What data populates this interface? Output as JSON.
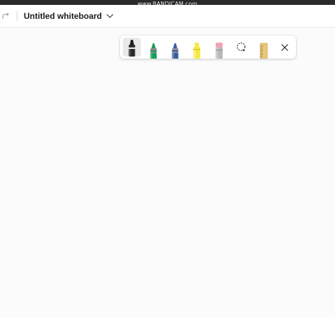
{
  "recorder": {
    "watermark": "www.BANDICAM.com"
  },
  "titlebar": {
    "redo_icon": "redo-icon",
    "title": "Untitled whiteboard",
    "chevron_icon": "chevron-down-icon"
  },
  "toolbar": {
    "tools": [
      {
        "name": "black-pen",
        "color": "#1f1f1f",
        "selected": true
      },
      {
        "name": "green-pen",
        "color": "#1a9b5a",
        "selected": false
      },
      {
        "name": "blue-pen",
        "color": "#3a5d9c",
        "selected": false
      },
      {
        "name": "highlighter",
        "color": "#f5e94a",
        "selected": false
      },
      {
        "name": "eraser",
        "color": "#f2a3b6",
        "selected": false
      },
      {
        "name": "lasso-select",
        "icon": "lasso-icon"
      },
      {
        "name": "ruler",
        "icon": "ruler-icon",
        "color": "#e8c878"
      },
      {
        "name": "close",
        "icon": "close-icon"
      }
    ]
  },
  "colors": {
    "canvas": "#fbfbfb",
    "titlebar": "#ffffff",
    "recorder_bar": "#2b2b2b"
  }
}
